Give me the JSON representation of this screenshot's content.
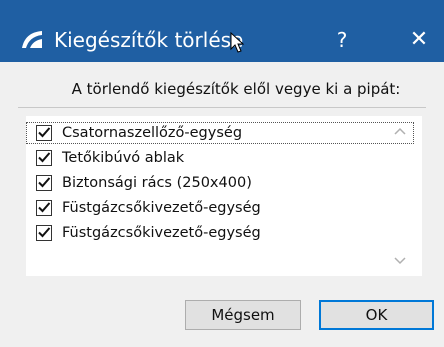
{
  "window": {
    "title": "Kiegészítők törlése",
    "help_label": "?",
    "close_label": "✕",
    "title_bar_color": "#1f5fa3"
  },
  "dialog": {
    "instruction": "A törlendő kiegészítők elől vegye ki a pipát:"
  },
  "list": {
    "items": [
      {
        "label": "Csatornaszellőző-egység",
        "checked": true
      },
      {
        "label": "Tetőkibúvó ablak",
        "checked": true
      },
      {
        "label": "Biztonsági rács (250x400)",
        "checked": true
      },
      {
        "label": "Füstgázcsőkivezető-egység",
        "checked": true
      },
      {
        "label": "Füstgázcsőkivezető-egység",
        "checked": true
      }
    ]
  },
  "buttons": {
    "cancel_label": "Mégsem",
    "ok_label": "OK",
    "accent_color": "#0078d7"
  },
  "icons": {
    "app": "app-logo-icon",
    "cursor": "mouse-cursor-icon",
    "check": "checkmark-icon",
    "scroll_up": "chevron-up-icon",
    "scroll_down": "chevron-down-icon"
  }
}
